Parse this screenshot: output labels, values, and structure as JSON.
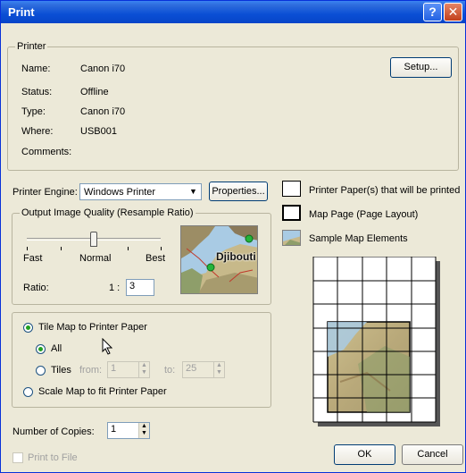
{
  "window": {
    "title": "Print",
    "help_label": "?",
    "close_label": "✕"
  },
  "printer": {
    "group_label": "Printer",
    "name_label": "Name:",
    "name_value": "Canon i70",
    "status_label": "Status:",
    "status_value": "Offline",
    "type_label": "Type:",
    "type_value": "Canon i70",
    "where_label": "Where:",
    "where_value": "USB001",
    "comments_label": "Comments:",
    "setup_button": "Setup..."
  },
  "engine": {
    "label": "Printer Engine:",
    "value": "Windows Printer",
    "properties_button": "Properties..."
  },
  "quality": {
    "group_label": "Output Image Quality (Resample Ratio)",
    "fast_label": "Fast",
    "normal_label": "Normal",
    "best_label": "Best",
    "slider_level": 0.5,
    "ratio_label": "Ratio:",
    "ratio_prefix": "1 :",
    "ratio_value": "3",
    "preview_map_label": "Djibouti"
  },
  "tiling": {
    "tile_label": "Tile Map to Printer Paper",
    "tile_selected": true,
    "all_label": "All",
    "tiles_label": "Tiles",
    "from_label": "from:",
    "from_value": "1",
    "to_label": "to:",
    "to_value": "25",
    "scale_label": "Scale Map to fit Printer Paper"
  },
  "copies": {
    "label": "Number of Copies:",
    "value": "1"
  },
  "print_to_file": {
    "label": "Print to File",
    "checked": false
  },
  "legend": {
    "paper_label": "Printer Paper(s) that will be printed",
    "map_page_label": "Map Page (Page Layout)",
    "sample_label": "Sample Map Elements"
  },
  "buttons": {
    "ok": "OK",
    "cancel": "Cancel"
  },
  "colors": {
    "titlebar": "#0a4fd5",
    "dialog_bg": "#ece9d8",
    "radio_dot": "#21a121"
  }
}
